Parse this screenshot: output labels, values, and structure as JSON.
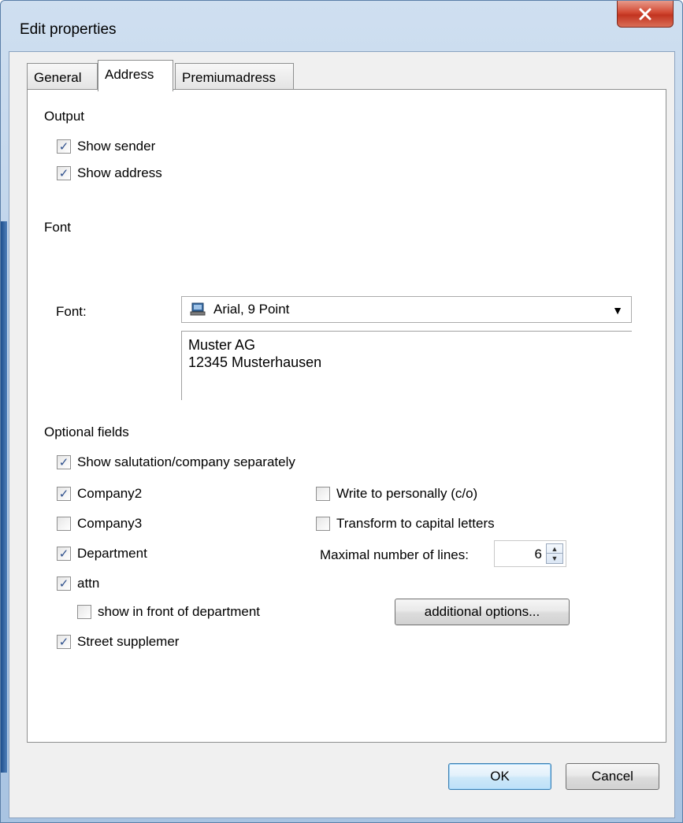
{
  "window": {
    "title": "Edit properties",
    "close_icon": "close-icon"
  },
  "tabs": [
    {
      "label": "General",
      "active": false
    },
    {
      "label": "Address",
      "active": true
    },
    {
      "label": "Premiumadress",
      "active": false
    }
  ],
  "output": {
    "label": "Output",
    "show_sender": {
      "label": "Show sender",
      "checked": true
    },
    "show_address": {
      "label": "Show address",
      "checked": true
    }
  },
  "font": {
    "section_label": "Font",
    "field_label": "Font:",
    "selected": "Arial,  9 Point",
    "preview_line1": "Muster AG",
    "preview_line2": "12345 Musterhausen"
  },
  "optional": {
    "label": "Optional fields",
    "salutation": {
      "label": "Show salutation/company separately",
      "checked": true
    },
    "company2": {
      "label": "Company2",
      "checked": true
    },
    "company3": {
      "label": "Company3",
      "checked": false
    },
    "department": {
      "label": "Department",
      "checked": true
    },
    "attn": {
      "label": "attn",
      "checked": true
    },
    "front_department": {
      "label": "show in front of department",
      "checked": false
    },
    "street_supplement": {
      "label": "Street supplemer",
      "checked": true
    },
    "write_personally": {
      "label": "Write to personally (c/o)",
      "checked": false
    },
    "capital_letters": {
      "label": "Transform to capital letters",
      "checked": false
    },
    "max_lines_label": "Maximal number of lines:",
    "max_lines_value": "6",
    "additional_button": "additional options..."
  },
  "buttons": {
    "ok": "OK",
    "cancel": "Cancel"
  },
  "colors": {
    "check": "#2d4f8c",
    "close": "#c23420"
  }
}
